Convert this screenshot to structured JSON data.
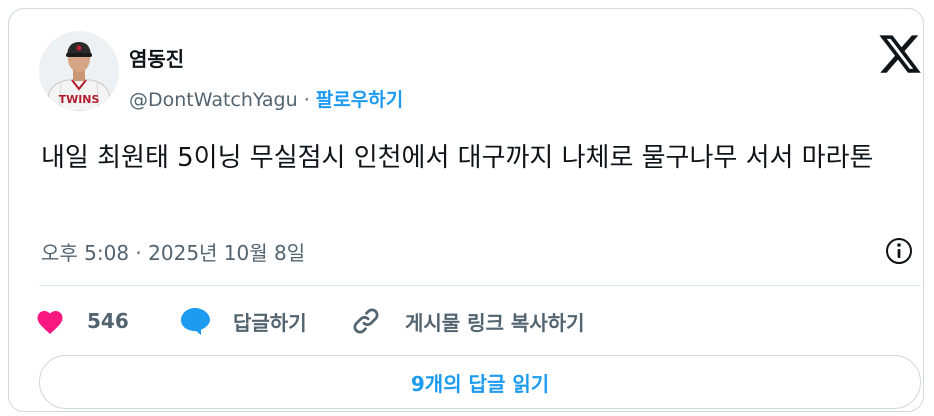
{
  "tweet": {
    "author_name": "염동진",
    "handle": "@DontWatchYagu",
    "separator": "·",
    "follow_label": "팔로우하기",
    "avatar_jersey_text": "TWINS",
    "text": "내일 최원태 5이닝 무실점시 인천에서 대구까지 나체로 물구나무 서서 마라톤",
    "timestamp": "오후 5:08 · 2025년 10월 8일"
  },
  "actions": {
    "like_count": "546",
    "reply_label": "답글하기",
    "copy_link_label": "게시물 링크 복사하기"
  },
  "read_replies_label": "9개의 답글 읽기",
  "icons": {
    "logo": "x-logo-icon",
    "info": "info-icon",
    "like": "heart-icon",
    "reply": "speech-bubble-icon",
    "link": "link-icon"
  },
  "colors": {
    "like": "#f91880",
    "reply": "#1d9bf0",
    "follow": "#1d9bf0",
    "secondary_text": "#536471"
  }
}
